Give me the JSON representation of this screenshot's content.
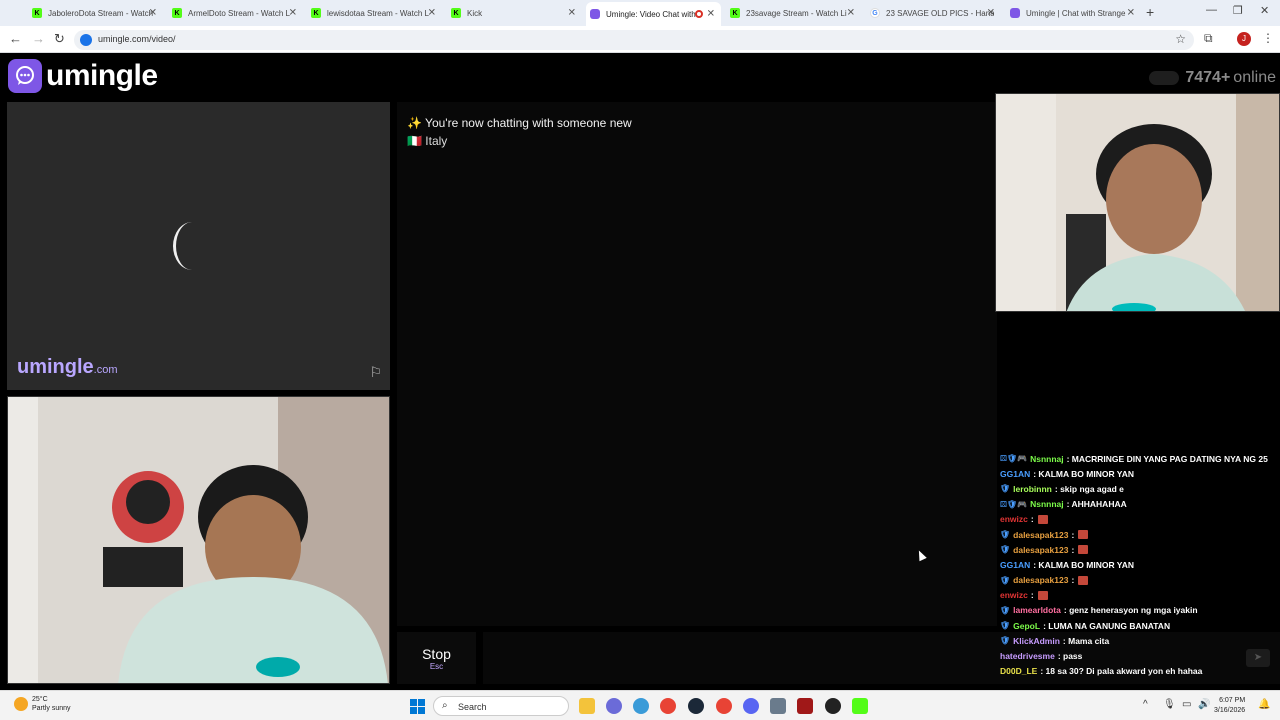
{
  "browser": {
    "tabs": [
      {
        "title": "JaboleroDota Stream - Watch",
        "icon": "kick",
        "active": false
      },
      {
        "title": "ArmelDoto Stream - Watch L",
        "icon": "kick",
        "active": false
      },
      {
        "title": "lewisdotaa Stream - Watch L",
        "icon": "kick",
        "active": false
      },
      {
        "title": "Kick",
        "icon": "kick",
        "active": false
      },
      {
        "title": "Umingle: Video Chat with",
        "icon": "umingle",
        "active": true
      },
      {
        "title": "23savage Stream - Watch Li",
        "icon": "kick",
        "active": false
      },
      {
        "title": "23 SAVAGE OLD PICS - Hana",
        "icon": "google",
        "active": false
      },
      {
        "title": "Umingle | Chat with Strange",
        "icon": "umingle",
        "active": false
      }
    ],
    "url": "umingle.com/video/",
    "profile_initial": "J"
  },
  "site": {
    "logo_text": "umingle",
    "online_count": "7474+",
    "online_label": "online",
    "watermark": "umingle",
    "watermark_domain": ".com"
  },
  "chat": {
    "messages": [
      "✨ You're now chatting with someone new",
      "🇮🇹 Italy"
    ],
    "stop_label": "Stop",
    "stop_key": "Esc"
  },
  "stream_chat": [
    {
      "user": "Nsnnnaj",
      "color": "#7CFC4A",
      "badges": "⚄🛡🎮",
      "text": ": MACRRINGE DIN YANG PAG DATING NYA NG 25",
      "emote": false
    },
    {
      "user": "GG1AN",
      "color": "#4a9eff",
      "badges": "",
      "text": ": KALMA BO MINOR YAN",
      "emote": false
    },
    {
      "user": "lerobinnn",
      "color": "#a8ff5a",
      "badges": "🛡",
      "text": ": skip nga agad e",
      "emote": false
    },
    {
      "user": "Nsnnnaj",
      "color": "#7CFC4A",
      "badges": "⚄🛡🎮",
      "text": ": AHHAHAHAA",
      "emote": false
    },
    {
      "user": "enwizc",
      "color": "#e03434",
      "badges": "",
      "text": ":",
      "emote": true
    },
    {
      "user": "dalesapak123",
      "color": "#e8a040",
      "badges": "🛡",
      "text": ":",
      "emote": true
    },
    {
      "user": "dalesapak123",
      "color": "#e8a040",
      "badges": "🛡",
      "text": ":",
      "emote": true
    },
    {
      "user": "GG1AN",
      "color": "#4a9eff",
      "badges": "",
      "text": ": KALMA BO MINOR YAN",
      "emote": false
    },
    {
      "user": "dalesapak123",
      "color": "#e8a040",
      "badges": "🛡",
      "text": ":",
      "emote": true
    },
    {
      "user": "enwizc",
      "color": "#e03434",
      "badges": "",
      "text": ":",
      "emote": true
    },
    {
      "user": "lamearldota",
      "color": "#ff6fa0",
      "badges": "🛡",
      "text": ": genz henerasyon ng mga iyakin",
      "emote": false
    },
    {
      "user": "GepoL",
      "color": "#7CFC4A",
      "badges": "🛡",
      "text": ": LUMA NA GANUNG BANATAN",
      "emote": false
    },
    {
      "user": "KlickAdmin",
      "color": "#c79cff",
      "badges": "🛡",
      "text": ": Mama cita",
      "emote": false
    },
    {
      "user": "hatedrivesme",
      "color": "#c79cff",
      "badges": "",
      "text": ": pass",
      "emote": false
    },
    {
      "user": "D00D_LE",
      "color": "#e8e04a",
      "badges": "",
      "text": ": 18 sa 30? Di pala akward yon eh hahaa",
      "emote": false
    }
  ],
  "taskbar": {
    "weather_temp": "25°C",
    "weather_desc": "Partly sunny",
    "search_label": "Search",
    "time": "6:07 PM",
    "date": "3/16/2026"
  }
}
